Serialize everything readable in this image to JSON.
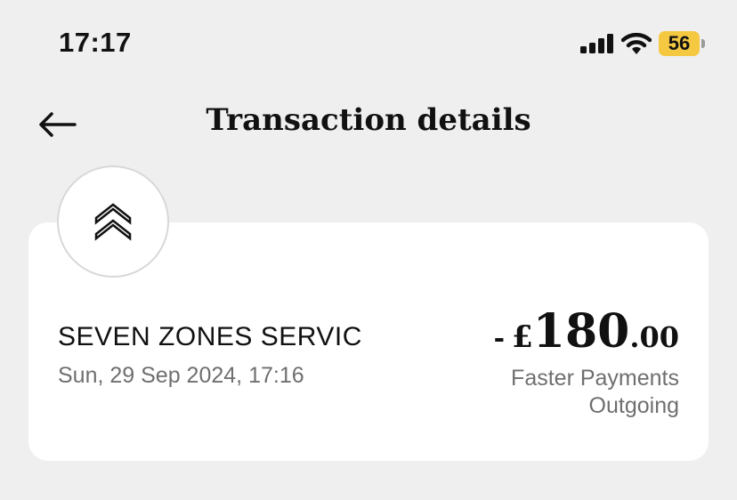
{
  "status_bar": {
    "time": "17:17",
    "battery_level": "56",
    "battery_color": "#f5c842",
    "icons": [
      "signal-icon",
      "wifi-icon",
      "battery-icon"
    ]
  },
  "header": {
    "back_icon": "arrow-left-icon",
    "title": "Transaction details"
  },
  "transaction": {
    "merchant_icon": "double-chevron-up-icon",
    "merchant_name": "SEVEN ZONES SERVIC",
    "date": "Sun, 29 Sep 2024, 17:16",
    "amount_sign": "-",
    "currency_symbol": "£",
    "amount_whole": "180",
    "amount_fraction": ".00",
    "payment_method": "Faster Payments",
    "direction": "Outgoing"
  },
  "colors": {
    "background": "#efefef",
    "card": "#ffffff",
    "secondary_text": "#6f6f6f"
  }
}
